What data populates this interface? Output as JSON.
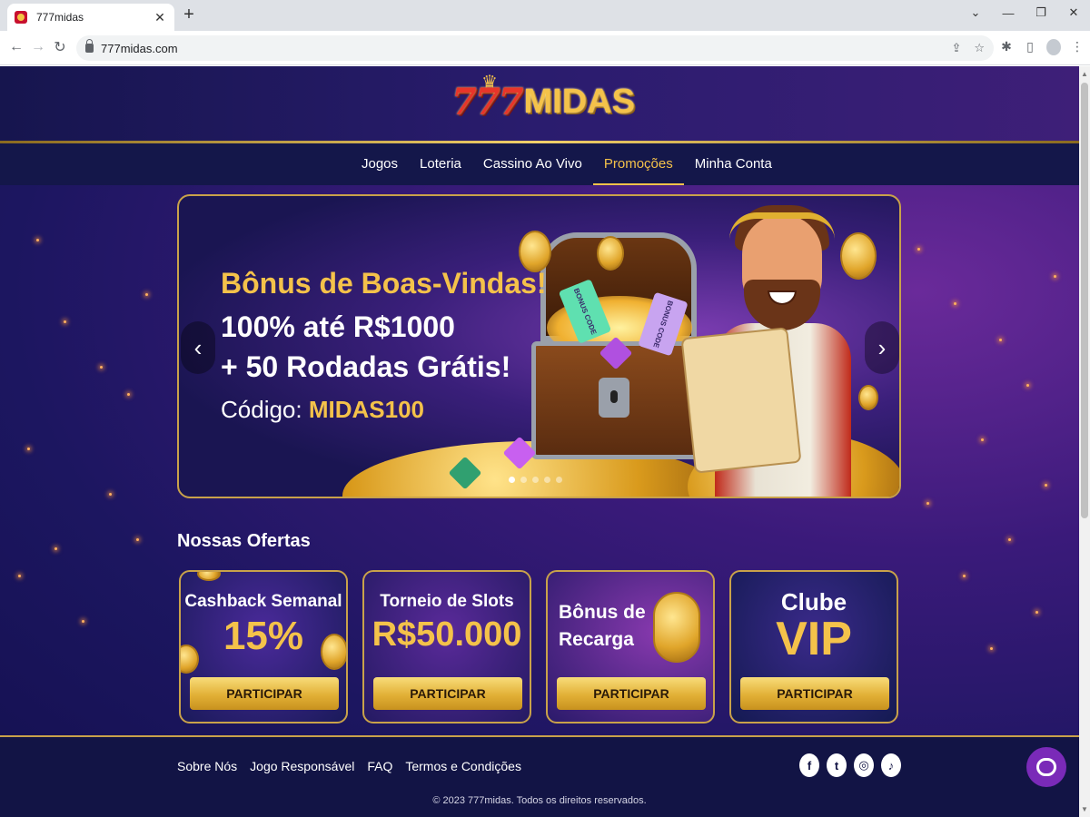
{
  "browser": {
    "tab_title": "777midas",
    "url": "777midas.com",
    "icons": [
      "close-icon",
      "plus-icon",
      "back-icon",
      "forward-icon",
      "reload-icon",
      "lock-icon",
      "share-icon",
      "star-icon",
      "extensions-icon",
      "sidepanel-icon",
      "profile-icon",
      "menu-icon",
      "minimize-icon",
      "restore-icon",
      "window-close-icon",
      "chevron-down-icon"
    ]
  },
  "site": {
    "logo_sevens": "777",
    "logo_name": "MIDAS",
    "nav": [
      "Jogos",
      "Loteria",
      "Cassino Ao Vivo",
      "Promoções",
      "Minha Conta"
    ],
    "active_nav": "Promoções"
  },
  "hero": {
    "title": "Bônus de Boas-Vindas!",
    "line1": "100% até R$1000",
    "line2": "+ 50 Rodadas Grátis!",
    "code_label": "Código:",
    "code_value": "MIDAS100",
    "ticket_text": "BONUS CODE",
    "slide_count": 5,
    "active_slide": 1
  },
  "offers": {
    "section_title": "Nossas Ofertas",
    "items": [
      {
        "title": "Cashback Semanal",
        "big": "15%",
        "cta": "PARTICIPAR"
      },
      {
        "title": "Torneio de Slots",
        "big": "R$50.000",
        "cta": "PARTICIPAR"
      },
      {
        "title": "Bônus de\nRecarga",
        "big": "",
        "cta": "PARTICIPAR"
      },
      {
        "title": "Clube",
        "big": "VIP",
        "cta": "PARTICIPAR"
      }
    ]
  },
  "footer": {
    "links": [
      "Sobre Nós",
      "Jogo Responsável",
      "FAQ",
      "Termos e Condições"
    ],
    "social": [
      "facebook-icon",
      "twitter-icon",
      "instagram-icon",
      "tiktok-icon"
    ],
    "copyright": "© 2023 777midas. Todos os direitos reservados."
  },
  "colors": {
    "gold": "#f4c24a",
    "navy": "#14174a",
    "purple": "#3a1a7a",
    "chat": "#7a2ab8"
  }
}
